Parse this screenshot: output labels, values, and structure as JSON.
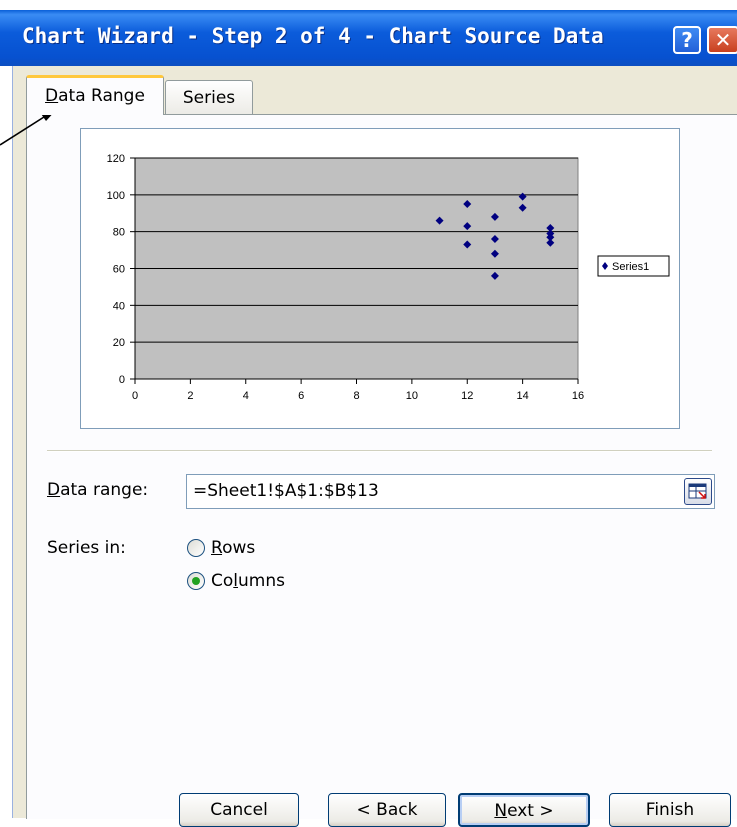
{
  "window": {
    "title": "Chart Wizard - Step 2 of 4 - Chart Source Data",
    "help_glyph": "?",
    "close_glyph": "✕"
  },
  "tabs": [
    {
      "label_first": "D",
      "label_rest": "ata Range",
      "active": true
    },
    {
      "label": "Series",
      "active": false
    }
  ],
  "chart_data": {
    "type": "scatter",
    "series": [
      {
        "name": "Series1",
        "color": "#000080",
        "points": [
          [
            11,
            86
          ],
          [
            12,
            95
          ],
          [
            12,
            83
          ],
          [
            12,
            73
          ],
          [
            13,
            88
          ],
          [
            13,
            76
          ],
          [
            13,
            68
          ],
          [
            13,
            56
          ],
          [
            14,
            99
          ],
          [
            14,
            93
          ],
          [
            15,
            82
          ],
          [
            15,
            79
          ],
          [
            15,
            77
          ],
          [
            15,
            74
          ]
        ]
      }
    ],
    "xlim": [
      0,
      16
    ],
    "ylim": [
      0,
      120
    ],
    "x_ticks": [
      "0",
      "2",
      "4",
      "6",
      "8",
      "10",
      "12",
      "14",
      "16"
    ],
    "y_ticks": [
      "0",
      "20",
      "40",
      "60",
      "80",
      "100",
      "120"
    ],
    "grid": true,
    "plot_background": "#c0c0c0",
    "legend_position": "right"
  },
  "form": {
    "data_range_label_first": "D",
    "data_range_label_rest": "ata range:",
    "data_range_value": "=Sheet1!$A$1:$B$13",
    "series_in_label": "Series in:",
    "rows_first": "R",
    "rows_rest": "ows",
    "columns_prefix": "Co",
    "columns_underline": "l",
    "columns_suffix": "umns",
    "selected": "Columns"
  },
  "buttons": {
    "cancel": "Cancel",
    "back": "< Back",
    "next_prefix": "",
    "next_underline": "N",
    "next_suffix": "ext >",
    "finish": "Finish"
  }
}
